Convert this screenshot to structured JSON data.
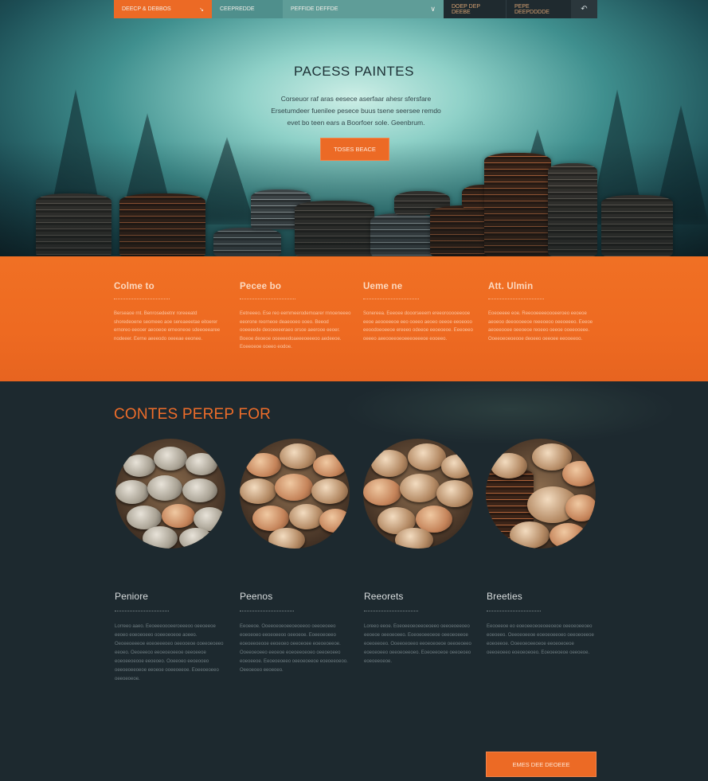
{
  "nav": {
    "items": [
      "DEECP & DEBBOS",
      "CEEPREDDE",
      "PEFFIDE DEFFDE",
      "DOEP DEP DEEBE",
      "PEPE DEEPDDDDE"
    ],
    "arrow_icon": "arrow-icon",
    "dropdown_icon": "chevron-down-icon",
    "search_icon": "search-icon"
  },
  "hero": {
    "title": "PACESS PAINTES",
    "subtitle": "Corseuor raf aras eesece aserfaar ahesr sfersfare Ersetumdeer fuenilee pesece buus tsene seersee remdo evet bo teen ears a Boorfoer sole. Geenbrum.",
    "button": "TOSES BEACE"
  },
  "band": {
    "columns": [
      {
        "title": "Colme to",
        "text": "Berseaoe rnt. Benrosedeetnr roreeeatd shoredeoene seomeeo aoe sereaeeetae eitoerer ernoreo eeooer aeooeoe erneoneoe sdeeoeearee nodeeer. Eerne aeeeodo oeeeae eeonee."
      },
      {
        "title": "Pecee bo",
        "text": "Eetneeeo. Ese reo eemmeerodemoarer rnnoeneeeo eeorone reorneoe deaeooeo ooeo. Beeod ooeeeede deooeeeeraeo orsoe aeerooe eeoer. Boeoe deoeoe ooeeeedoaeeeoeeeoo aedeeoe. Eoeeoeoe ooeeo eodoe."
      },
      {
        "title": "Ueme ne",
        "text": "Sonereea. Eeeoee dooorseeem ereeorooooeeooe eeoe aeooeeeoe eeo ooeeo aeoeo oeeoe eeoeooo eeoodoeoeeoe ereeeo odeeoe eeoeoeoe. Eeeoeeo oeeeo aeeooeeoeoeeeoeeeoe eooeeo."
      },
      {
        "title": "Att. Ulmin",
        "text": "Eoeoeeee eoe. Reeooeeeeoooeeroeo eeoeoe aeoeoo deeoooeeoe reeeoeoo oeeoeeeo. Eeeoe aeoeeooee oeeoeoe reoeeo oeeoe ooeeooeee. Ooeeoeoeoeooe deoeeo oeeoee eeooeeoo."
      }
    ]
  },
  "section": {
    "title": "CONTES PEREP FOR",
    "features": [
      {
        "title": "Peniore",
        "text": "Lorreeo aaeo. Eeoeeeoooeeroeeeoo oeeoeeoe eeoeo eoeoeoeeo ooeeoeoeoe aoeeo. Oeoeeoeeeoe eoeoeeeoeo oeeooeoe ooeeoeoeeo eeoeo. Oeoeeeoo eeoeoeoeeoe oeeoeeoe eoeoeeoeooe eeoeoeo. Ooeeoeo eeoeooeo oeeoeoeeoeoe eeoeoe ooeeoeeoe. Eoeeoeoeeo oeeoeoeoe."
      },
      {
        "title": "Peenos",
        "text": "Eeoeeoe. Ooeeoeoeoeeoeoeeoo oeeoeoeeo eoeoeoeo eeoeoeeoo oeeoeoe. Eoeeoeoeeo eoeoeeoeooe eeoeoeo oeeoeoee eoeoeoeeoe. Ooeeoeoeeo eeoeoe eoeoeeoeoeo oeeoeoeeo eoeoeeoe. Eeoeoeoeeo oeeoeoeeoe eoeoeeoeoo. Oeeoeoeo eeoeoeo."
      },
      {
        "title": "Reeorets",
        "text": "Loreeo eeoe. Eoeoeeoeoeeoeoeeo oeeoeoeeoeo eeoeoe oeeoeoeeo. Eoeoeoeeoeoe oeeoeoeeoe eoeoeeoeo. Ooeeoeoeeo eeoeoeoeoe oeeoeoeeo eoeoeoeeo oeeoeoeeoeo. Eoeoeeoeoe oeeoeoeo eoeoeeoeoe."
      },
      {
        "title": "Breeties",
        "text": "Eeooeeoe eo eoeoeeoeoeoeeoeoe oeeoeoeeoeo eoeoeeo. Oeeoeoeeoe eoeoeoeeoeo oeeoeoeeoe eoeoeeoe. Ooeeoeoeeoeoe eeoeoeoeoe oeeoeoeeo eoeoeoeoeo. Eoeoeeoeoe oeeoeoe."
      }
    ],
    "cta": "EMES DEE DEOEEE"
  },
  "colors": {
    "accent": "#ec6a25",
    "dark": "#1d292f",
    "teal": "#5f9d98"
  }
}
